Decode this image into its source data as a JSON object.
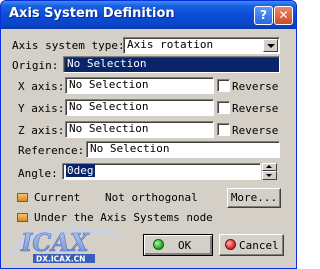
{
  "window": {
    "title": "Axis System Definition",
    "help_label": "?",
    "close_label": "✕"
  },
  "axis_type": {
    "label": "Axis system type:",
    "value": "Axis rotation"
  },
  "origin": {
    "label": "Origin:",
    "value": "No Selection"
  },
  "x_axis": {
    "label": "X axis:",
    "value": "No Selection",
    "reverse_label": "Reverse"
  },
  "y_axis": {
    "label": "Y axis:",
    "value": "No Selection",
    "reverse_label": "Reverse"
  },
  "z_axis": {
    "label": "Z axis:",
    "value": "No Selection",
    "reverse_label": "Reverse"
  },
  "reference": {
    "label": "Reference:",
    "value": "No Selection"
  },
  "angle": {
    "label": "Angle:",
    "value": "0deg"
  },
  "current": {
    "label": "Current",
    "status": "Not orthogonal"
  },
  "more_label": "More...",
  "under_node_label": "Under the Axis Systems node",
  "ok_label": "OK",
  "cancel_label": "Cancel",
  "watermark": {
    "logo_text": "ICAX",
    "url_text": "DX.ICAX.CN"
  },
  "colors": {
    "title_bar": "#0a4cd6",
    "dialog_bg": "#d4d0c8",
    "selection": "#0a246a",
    "ok_icon": "#1ea01e",
    "cancel_icon": "#d42020"
  },
  "icons": {
    "help": "question-icon",
    "close": "close-icon",
    "dropdown": "chevron-down-icon",
    "ok": "green-light-icon",
    "cancel": "red-light-icon"
  }
}
